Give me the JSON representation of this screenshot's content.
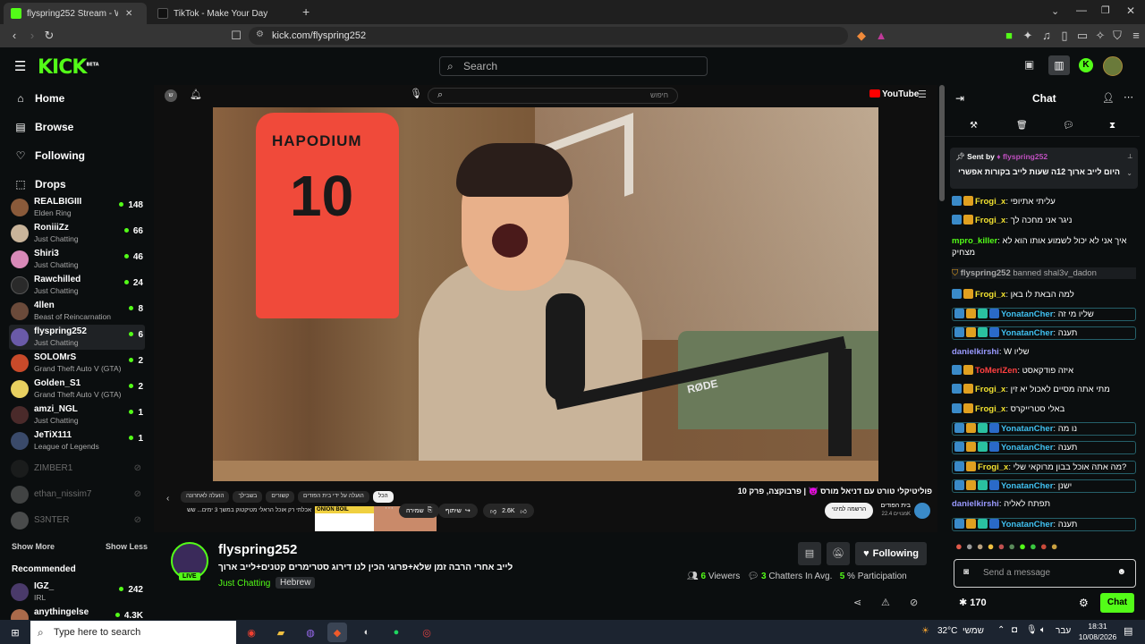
{
  "browser": {
    "tabs": [
      {
        "title": "flyspring252 Stream - Watch",
        "active": true
      },
      {
        "title": "TikTok - Make Your Day",
        "active": false
      }
    ],
    "url": "kick.com/flyspring252"
  },
  "kick": {
    "logo": "KICK",
    "logo_sup": "BETA",
    "search_placeholder": "Search",
    "accent": "#53fc18"
  },
  "sidebar": {
    "nav": [
      {
        "label": "Home",
        "icon": "home-icon"
      },
      {
        "label": "Browse",
        "icon": "browse-icon"
      },
      {
        "label": "Following",
        "icon": "heart-icon"
      },
      {
        "label": "Drops",
        "icon": "drops-icon"
      }
    ],
    "following": [
      {
        "name": "REALBIGIII",
        "game": "Elden Ring",
        "viewers": "148",
        "color": "#8a5a3a"
      },
      {
        "name": "RoniiiZz",
        "game": "Just Chatting",
        "viewers": "66",
        "color": "#c9b49a"
      },
      {
        "name": "Shiri3",
        "game": "Just Chatting",
        "viewers": "46",
        "color": "#d889b8"
      },
      {
        "name": "Rawchilled",
        "game": "Just Chatting",
        "viewers": "24",
        "color": "#2a2a2a"
      },
      {
        "name": "4llen",
        "game": "Beast of Reincarnation",
        "viewers": "8",
        "color": "#6a4a3a"
      },
      {
        "name": "flyspring252",
        "game": "Just Chatting",
        "viewers": "6",
        "color": "#6a5aa8"
      },
      {
        "name": "SOLOMrS",
        "game": "Grand Theft Auto V (GTA)",
        "viewers": "2",
        "color": "#c84a2a"
      },
      {
        "name": "Golden_S1",
        "game": "Grand Theft Auto V (GTA)",
        "viewers": "2",
        "color": "#e8d060"
      },
      {
        "name": "amzi_NGL",
        "game": "Just Chatting",
        "viewers": "1",
        "color": "#4a2a2a"
      },
      {
        "name": "JeTiX111",
        "game": "League of Legends",
        "viewers": "1",
        "color": "#3a4a6a"
      }
    ],
    "offline": [
      {
        "name": "ZIMBER1"
      },
      {
        "name": "ethan_nissim7"
      },
      {
        "name": "S3NTER"
      }
    ],
    "show_more": "Show More",
    "show_less": "Show Less",
    "recommended_title": "Recommended",
    "recommended": [
      {
        "name": "IGZ_",
        "game": "IRL",
        "viewers": "242",
        "color": "#4a3a6a"
      },
      {
        "name": "anythingelse",
        "game": "",
        "viewers": "4.3K",
        "color": "#aa6a4a"
      }
    ]
  },
  "youtube": {
    "search_placeholder": "חיפוש",
    "logo": "YouTube",
    "chips": [
      "הכל",
      "הועלה על ידי בית הפודים",
      "קשורים",
      "בשבילך",
      "הועלה לאחרונה"
    ],
    "video_title": "פוליטיקלי טורט עם דניאל מורס 👿 | פרבוקצה, פרק 10",
    "channel": "בית הפודים",
    "subs": "מנויים 22.4K",
    "subscribe": "הרשמה למינוי",
    "likes": "2.6K",
    "share": "שיתוף",
    "save": "שמירה",
    "related_title": "אכלתי רק אוכל הראלי מטיקטוק במשך 3 ימים... שש",
    "related_thumb": "ONION BOIL",
    "jersey_text": "HAPODIUM",
    "jersey_number": "10",
    "mic_brand": "RØDE"
  },
  "stream": {
    "channel": "flyspring252",
    "title": "לייב אחרי הרבה זמן שלא+פרוגי הכין לנו דירוג סטרימרים קטנים+לייב ארוך",
    "category": "Just Chatting",
    "tag": "Hebrew",
    "live": "LIVE",
    "following_btn": "Following",
    "viewers": "6",
    "viewers_label": "Viewers",
    "chatters": "3",
    "chatters_label": "Chatters In Avg.",
    "participation": "5",
    "participation_label": "% Participation"
  },
  "chat": {
    "title": "Chat",
    "pinned_by_label": "Sent by",
    "pinned_by": "flyspring252",
    "pinned_text": "היום לייב ארוך 12ה שעות לייב בקורות אפשרי",
    "input_placeholder": "Send a message",
    "points": "170",
    "send_button": "Chat",
    "messages": [
      {
        "user": "Frogi_x",
        "color": "#f0e030",
        "text": "עליתי אתיופי",
        "badges": 2,
        "boxed": false
      },
      {
        "user": "Frogi_x",
        "color": "#f0e030",
        "text": "ניגר אני מחכה לך",
        "badges": 2,
        "boxed": false
      },
      {
        "user": "mpro_killer",
        "color": "#53fc18",
        "text": "איך אני לא יכול לשמוע אותו הוא לא מצחיק",
        "badges": 0,
        "boxed": false
      },
      {
        "user": "flyspring252",
        "color": "#a8a8a8",
        "text": "banned shal3v_dadon",
        "badges": 0,
        "boxed": false,
        "system": true
      },
      {
        "user": "Frogi_x",
        "color": "#f0e030",
        "text": "למה הבאת לו באן",
        "badges": 2,
        "boxed": false
      },
      {
        "user": "YonatanCher",
        "color": "#40c0f0",
        "text": "שליו מי זה",
        "badges": 4,
        "boxed": true
      },
      {
        "user": "YonatanCher",
        "color": "#40c0f0",
        "text": "תענה",
        "badges": 4,
        "boxed": true
      },
      {
        "user": "danielkirshi",
        "color": "#9a9aff",
        "text": "W שליו",
        "badges": 0,
        "boxed": false
      },
      {
        "user": "ToMeriZen",
        "color": "#ff4040",
        "text": "איזה פודקאסט",
        "badges": 2,
        "boxed": false
      },
      {
        "user": "Frogi_x",
        "color": "#f0e030",
        "text": "מתי אתה מסיים לאכול יא זין",
        "badges": 2,
        "boxed": false
      },
      {
        "user": "Frogi_x",
        "color": "#f0e030",
        "text": "באלי סטרייקרס",
        "badges": 2,
        "boxed": false
      },
      {
        "user": "YonatanCher",
        "color": "#40c0f0",
        "text": "נו מה",
        "badges": 4,
        "boxed": true
      },
      {
        "user": "YonatanCher",
        "color": "#40c0f0",
        "text": "תענה",
        "badges": 4,
        "boxed": true
      },
      {
        "user": "Frogi_x",
        "color": "#f0e030",
        "text": "מה אתה אוכל בבון מרוקאי שלי?",
        "badges": 2,
        "boxed": true
      },
      {
        "user": "YonatanCher",
        "color": "#40c0f0",
        "text": "ישנן",
        "badges": 4,
        "boxed": true
      },
      {
        "user": "danielkirshi",
        "color": "#9a9aff",
        "text": "תפתח לאליה",
        "badges": 0,
        "boxed": false
      },
      {
        "user": "YonatanCher",
        "color": "#40c0f0",
        "text": "תענה",
        "badges": 4,
        "boxed": true
      }
    ]
  },
  "taskbar": {
    "search_placeholder": "Type here to search",
    "weather": "32°C",
    "weather_label": "שמשי",
    "lang": "עבר",
    "time": "18:31",
    "date": "10/08/2026"
  }
}
